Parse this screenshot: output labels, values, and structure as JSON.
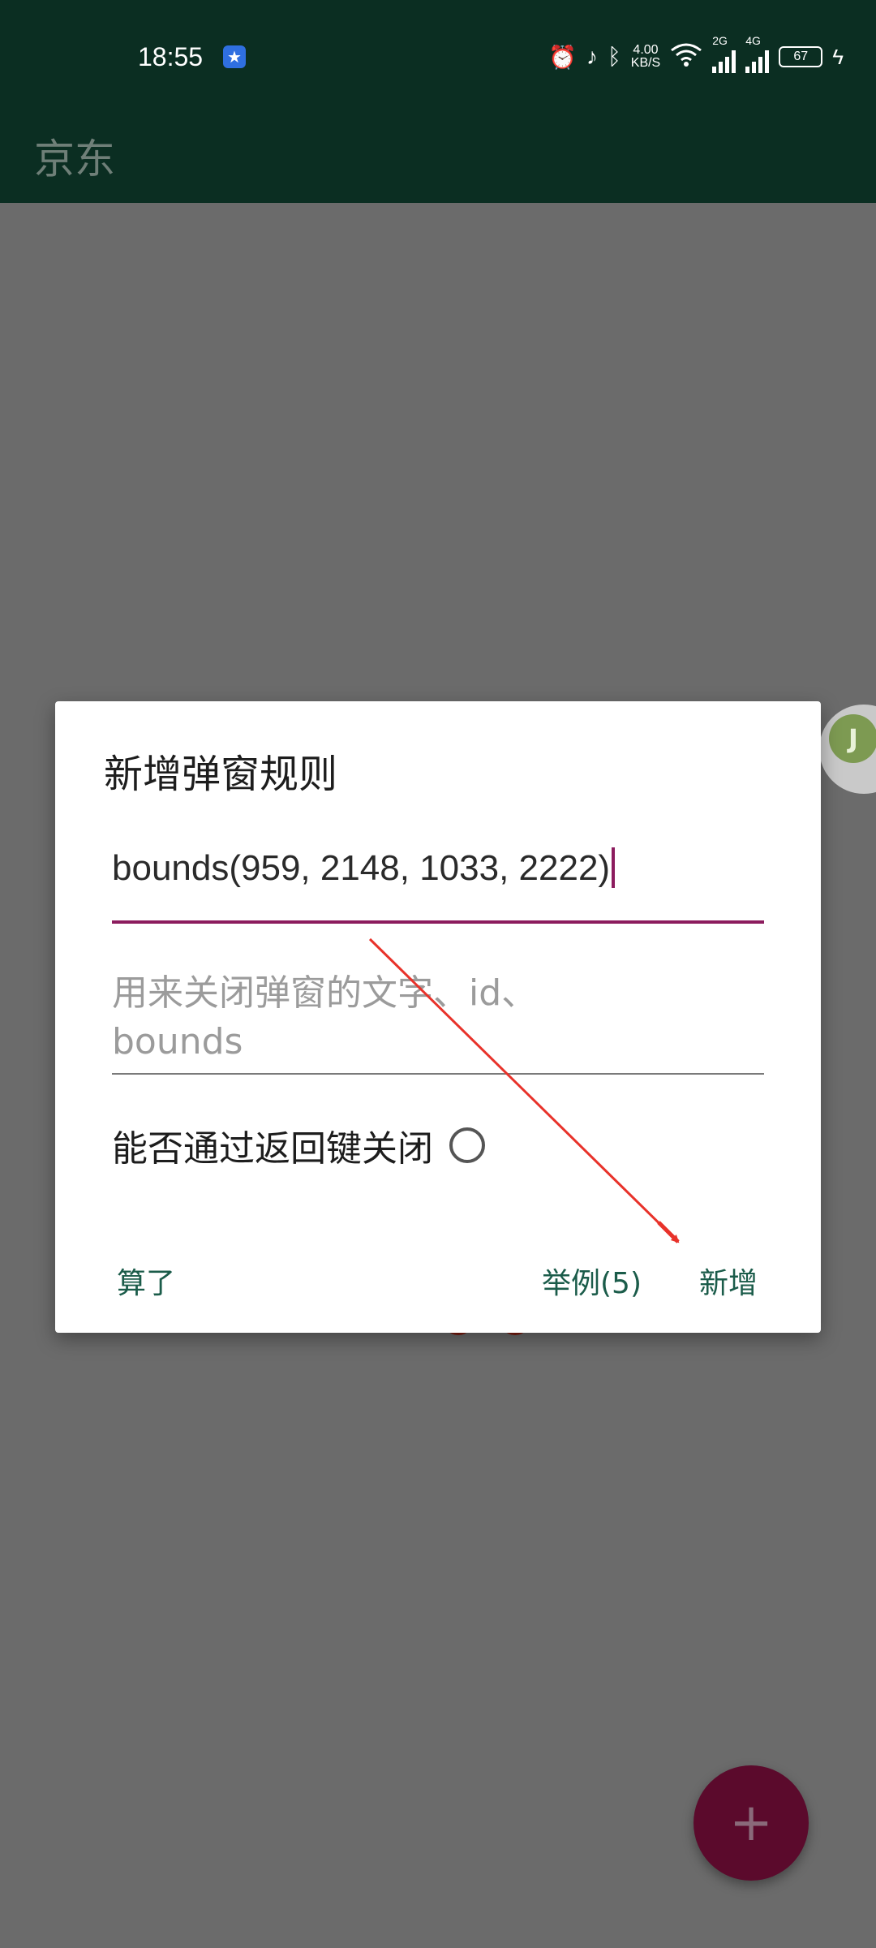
{
  "status_bar": {
    "time": "18:55",
    "net_speed_value": "4.00",
    "net_speed_unit": "KB/S",
    "sim1_label": "2G",
    "sim2_label": "4G",
    "battery": "67"
  },
  "app_bar": {
    "title": "京东"
  },
  "dialog": {
    "title": "新增弹窗规则",
    "input_value": "bounds(959, 2148, 1033, 2222)",
    "placeholder": "用来关闭弹窗的文字、id、bounds",
    "toggle_label": "能否通过返回键关闭",
    "cancel_label": "算了",
    "example_label": "举例(5)",
    "add_label": "新增"
  },
  "floating": {
    "letter": "J"
  },
  "fab": {
    "icon": "plus-icon",
    "glyph": "+"
  },
  "colors": {
    "appbar": "#0b2e22",
    "accent": "#8c1c5e",
    "button_text": "#1b5c4a",
    "fab": "#5b0a2c",
    "arrow": "#e8322a"
  }
}
